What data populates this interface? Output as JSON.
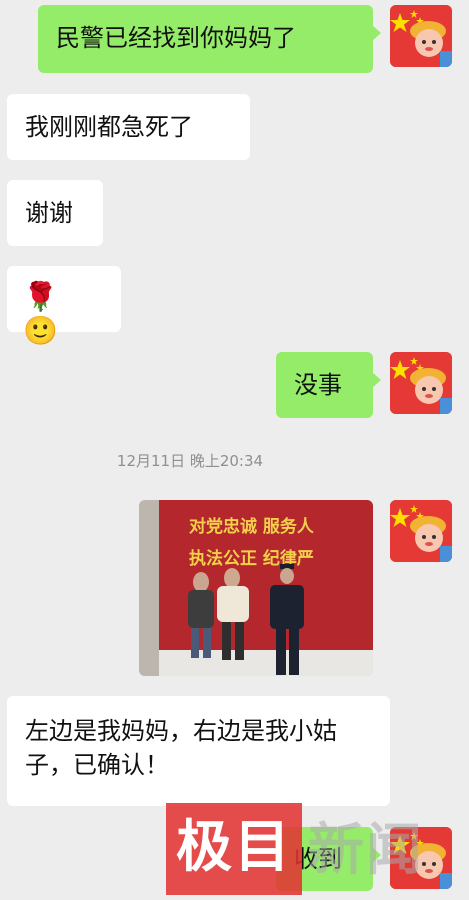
{
  "messages": {
    "m1": "民警已经找到你妈妈了",
    "m2": "我刚刚都急死了",
    "m3": "谢谢",
    "m4_emoji": [
      "🌹",
      "🙂"
    ],
    "m5": "没事",
    "timestamp": "12月11日 晚上20:34",
    "m7": "左边是我妈妈，右边是我小姑子，已确认！",
    "m8": "收到"
  },
  "photo": {
    "banner_line1": "对党忠诚  服务人",
    "banner_line2": "执法公正  纪律严"
  },
  "watermark": {
    "box": "极目",
    "text": "新闻"
  },
  "colors": {
    "my_bubble": "#95ec69",
    "other_bubble": "#ffffff",
    "background": "#ededed"
  }
}
